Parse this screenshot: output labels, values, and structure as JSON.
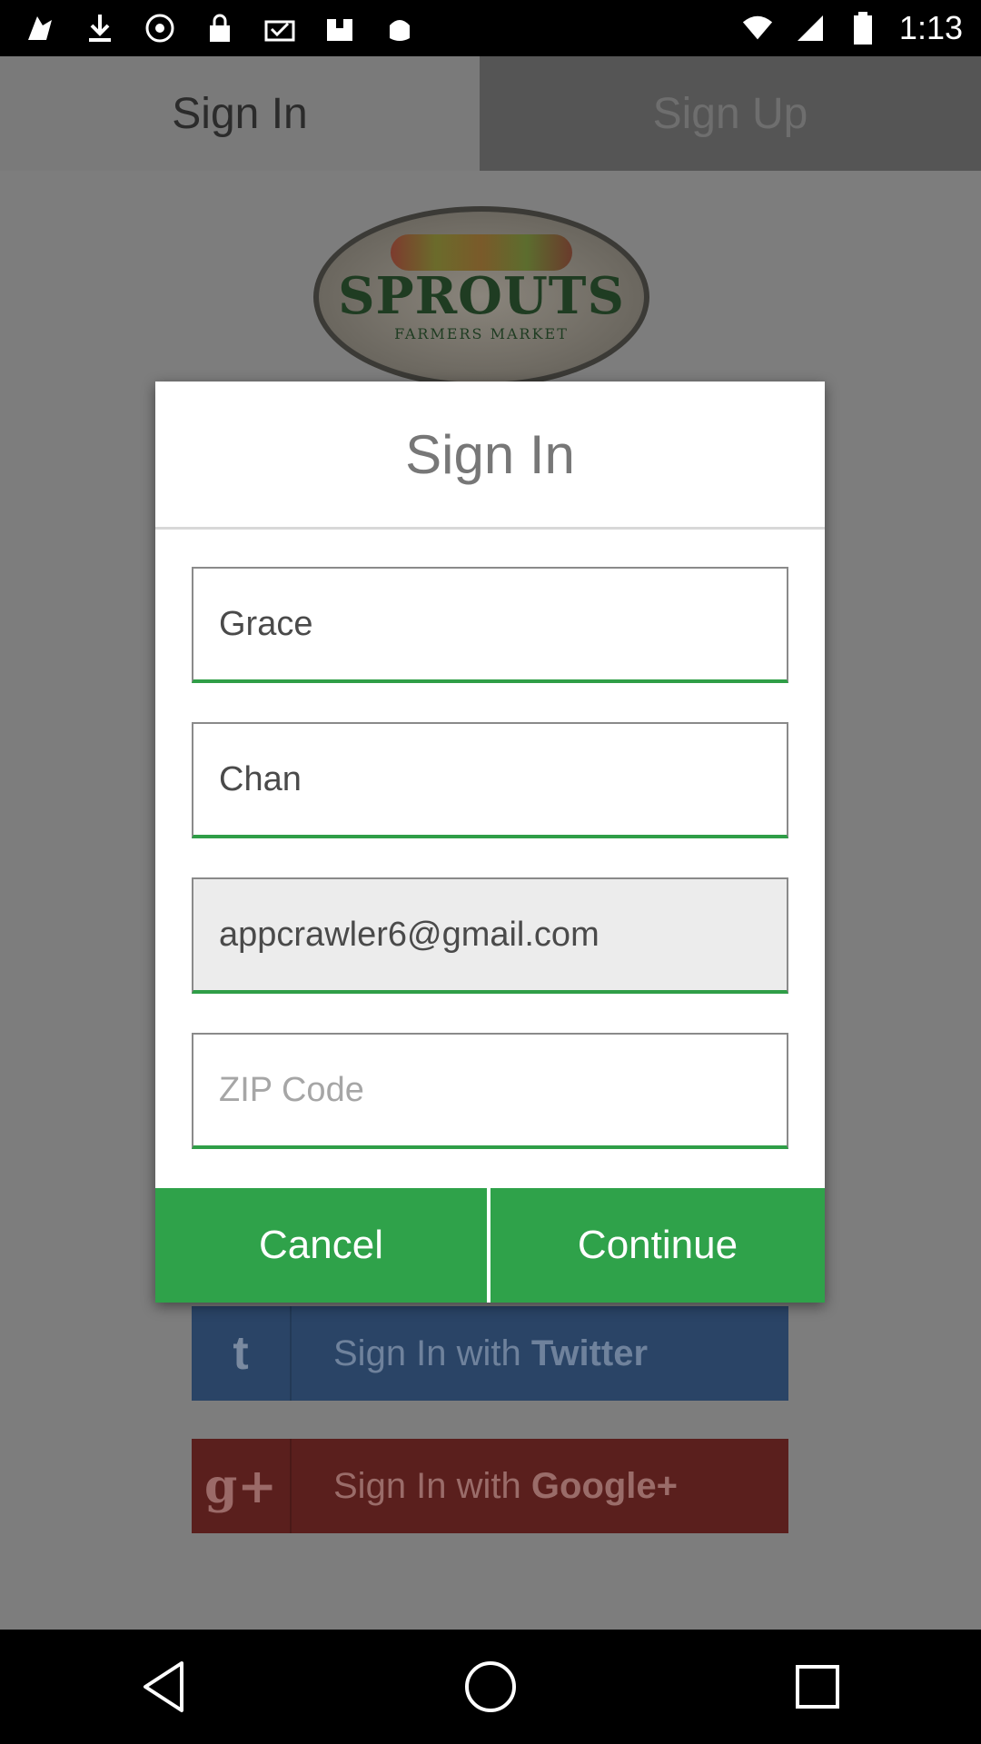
{
  "status_bar": {
    "time": "1:13",
    "left_icons": [
      "app-icon",
      "download-icon",
      "media-icon",
      "lock-icon",
      "wallet-icon",
      "save-icon",
      "game-icon"
    ],
    "right_icons": [
      "wifi-icon",
      "cellular-icon",
      "battery-icon"
    ]
  },
  "background": {
    "tabs": {
      "signin": "Sign In",
      "signup": "Sign Up"
    },
    "logo": {
      "title": "SPROUTS",
      "subtitle": "FARMERS MARKET"
    },
    "twitter": {
      "icon": "t",
      "prefix": "Sign In with ",
      "brand": "Twitter"
    },
    "google": {
      "icon": "g+",
      "prefix": "Sign In with ",
      "brand": "Google+"
    }
  },
  "dialog": {
    "title": "Sign In",
    "first_name": "Grace",
    "last_name": "Chan",
    "email": "appcrawler6@gmail.com",
    "zip_placeholder": "ZIP Code",
    "cancel_label": "Cancel",
    "continue_label": "Continue"
  },
  "colors": {
    "accent_green": "#2fa24a",
    "underline_green": "#2f9e47",
    "twitter_bg": "#2a4466",
    "google_bg": "#5a1f1d"
  },
  "nav_bar": {
    "icons": [
      "back-icon",
      "home-icon",
      "recents-icon"
    ]
  }
}
